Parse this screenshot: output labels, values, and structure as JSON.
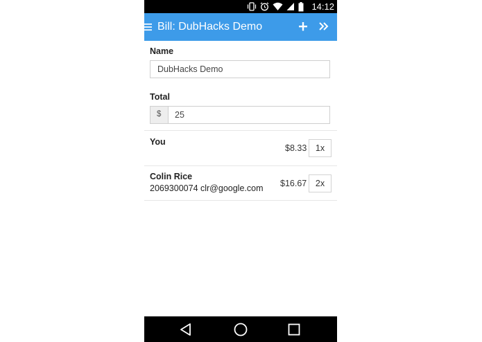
{
  "status_bar": {
    "time": "14:12",
    "icons": [
      "vibrate-icon",
      "alarm-icon",
      "wifi-icon",
      "signal-icon",
      "battery-icon"
    ]
  },
  "app_bar": {
    "title": "Bill: DubHacks Demo",
    "menu_icon": "menu-icon",
    "add_icon": "add-icon",
    "next_icon": "double-chevron-right-icon",
    "color": "#3d9be9"
  },
  "form": {
    "name_label": "Name",
    "name_value": "DubHacks Demo",
    "total_label": "Total",
    "currency_symbol": "$",
    "total_value": "25"
  },
  "participants": [
    {
      "name": "You",
      "contact": "",
      "amount": "$8.33",
      "share": "1x"
    },
    {
      "name": "Colin Rice",
      "contact": "2069300074 clr@google.com",
      "amount": "$16.67",
      "share": "2x"
    }
  ],
  "nav_bar": {
    "icons": [
      "back-icon",
      "home-icon",
      "recents-icon"
    ]
  }
}
